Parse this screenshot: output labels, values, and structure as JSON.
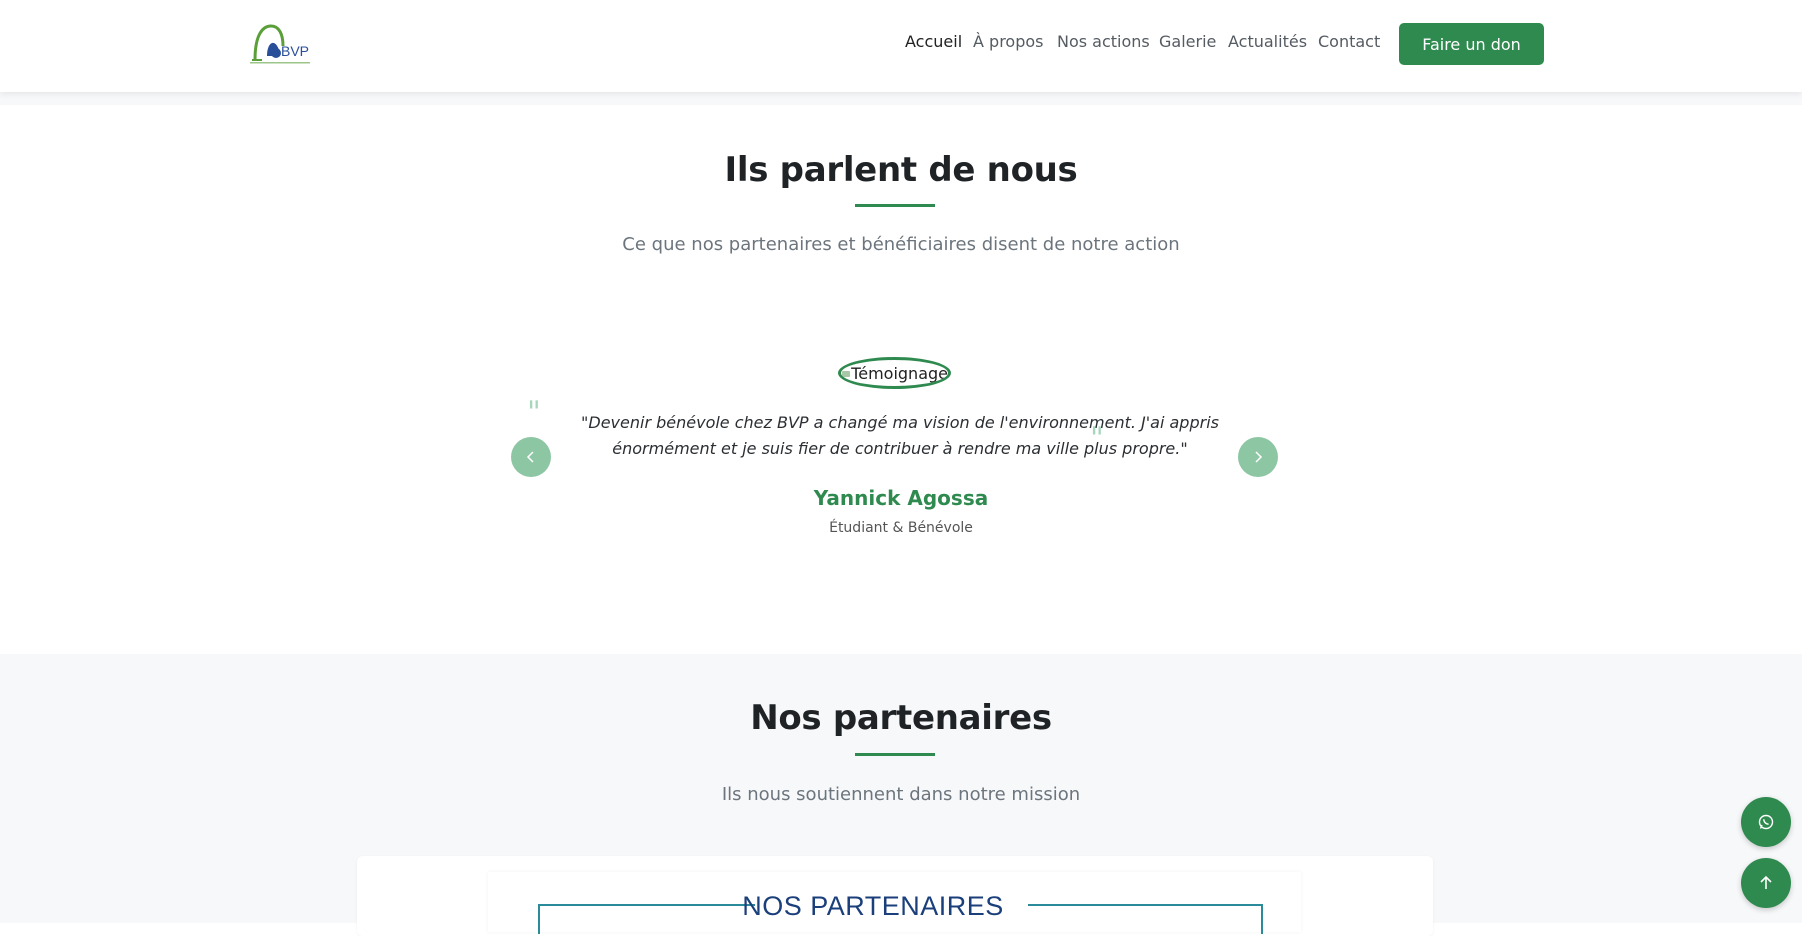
{
  "header": {
    "logo_text": "BVP",
    "nav": [
      {
        "label": "Accueil",
        "active": true
      },
      {
        "label": "À propos",
        "active": false
      },
      {
        "label": "Nos actions",
        "active": false
      },
      {
        "label": "Galerie",
        "active": false
      },
      {
        "label": "Actualités",
        "active": false
      },
      {
        "label": "Contact",
        "active": false
      }
    ],
    "donate_label": "Faire un don"
  },
  "testimonials": {
    "title": "Ils parlent de nous",
    "subtitle": "Ce que nos partenaires et bénéficiaires disent de notre action",
    "image_alt": "Témoignage",
    "quote": "\"Devenir bénévole chez BVP a changé ma vision de l'environnement. J'ai appris énormément et je suis fier de contribuer à rendre ma ville plus propre.\"",
    "name": "Yannick Agossa",
    "role": "Étudiant & Bénévole"
  },
  "partners": {
    "title": "Nos partenaires",
    "subtitle": "Ils nous soutiennent dans notre mission",
    "image_title": "NOS PARTENAIRES"
  },
  "colors": {
    "accent": "#2f8a4f",
    "accent_light": "#8dc6a3",
    "section_bg": "#f7f8fa"
  },
  "icons": {
    "prev": "chevron-left-icon",
    "next": "chevron-right-icon",
    "whatsapp": "whatsapp-icon",
    "back_to_top": "arrow-up-icon"
  }
}
